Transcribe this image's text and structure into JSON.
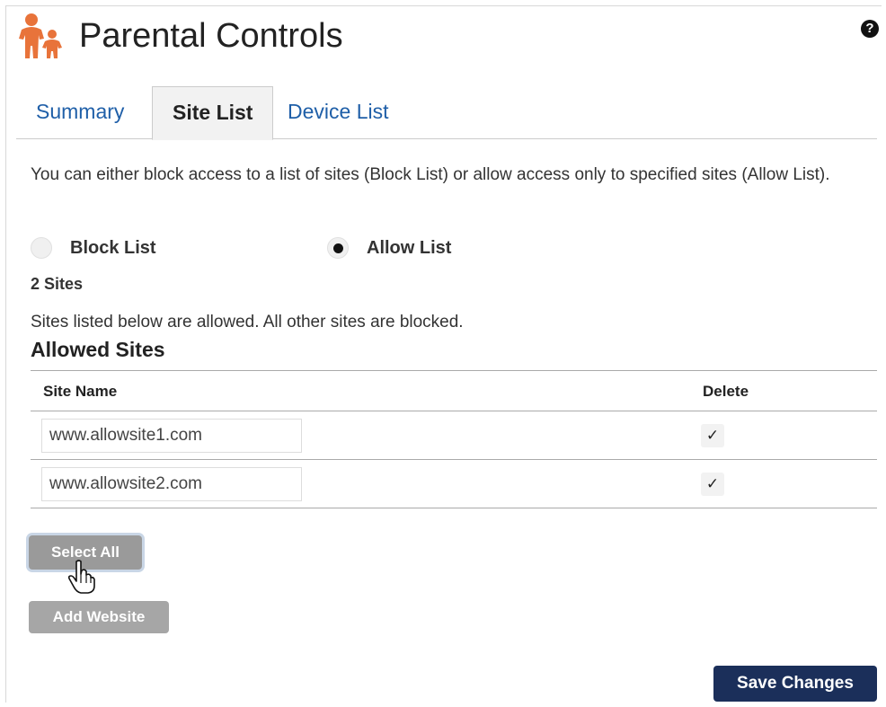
{
  "header": {
    "title": "Parental Controls",
    "logo_icon": "family-icon",
    "help_icon": "question-circle-icon"
  },
  "tabs": [
    {
      "label": "Summary",
      "active": false
    },
    {
      "label": "Site List",
      "active": true
    },
    {
      "label": "Device List",
      "active": false
    }
  ],
  "description": "You can either block access to a list of sites (Block List) or allow access only to specified sites (Allow List).",
  "mode": {
    "options": [
      {
        "label": "Block List",
        "checked": false
      },
      {
        "label": "Allow List",
        "checked": true
      }
    ]
  },
  "site_count": "2 Sites",
  "note": "Sites listed below are allowed. All other sites are blocked.",
  "section_title": "Allowed Sites",
  "table": {
    "columns": [
      "Site Name",
      "Delete"
    ],
    "rows": [
      {
        "site": "www.allowsite1.com",
        "delete": "✓"
      },
      {
        "site": "www.allowsite2.com",
        "delete": "✓"
      }
    ]
  },
  "buttons": {
    "select_all": "Select All",
    "add_website": "Add Website",
    "save_changes": "Save Changes"
  },
  "colors": {
    "accent_orange": "#e8733a",
    "link_blue": "#1f5fa8",
    "save_navy": "#1b2f5a",
    "button_gray": "#a6a6a6"
  }
}
